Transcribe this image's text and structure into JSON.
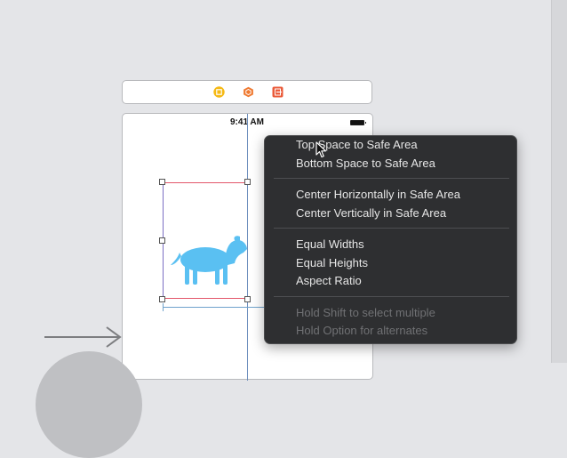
{
  "scene_dock": {
    "icons": [
      "view-controller-icon",
      "first-responder-icon",
      "exit-icon"
    ],
    "colors": [
      "#f5b915",
      "#ef7a32",
      "#ea5b3a"
    ]
  },
  "phone": {
    "status_time": "9:41 AM",
    "image_icon": "dog-icon",
    "image_color": "#5ac0f2"
  },
  "context_menu": {
    "items": [
      {
        "label": "Top Space to Safe Area",
        "enabled": true
      },
      {
        "label": "Bottom Space to Safe Area",
        "enabled": true
      },
      {
        "label": "Center Horizontally in Safe Area",
        "enabled": true
      },
      {
        "label": "Center Vertically in Safe Area",
        "enabled": true
      },
      {
        "label": "Equal Widths",
        "enabled": true
      },
      {
        "label": "Equal Heights",
        "enabled": true
      },
      {
        "label": "Aspect Ratio",
        "enabled": true
      },
      {
        "label": "Hold Shift to select multiple",
        "enabled": false
      },
      {
        "label": "Hold Option for alternates",
        "enabled": false
      }
    ]
  }
}
